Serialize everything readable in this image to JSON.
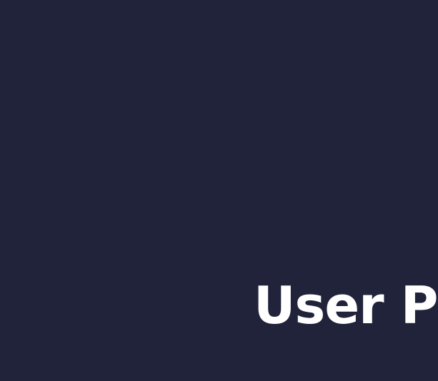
{
  "colors": {
    "background": "#20233a",
    "title_text": "#ffffff"
  },
  "heading": {
    "title": "User Pe"
  }
}
